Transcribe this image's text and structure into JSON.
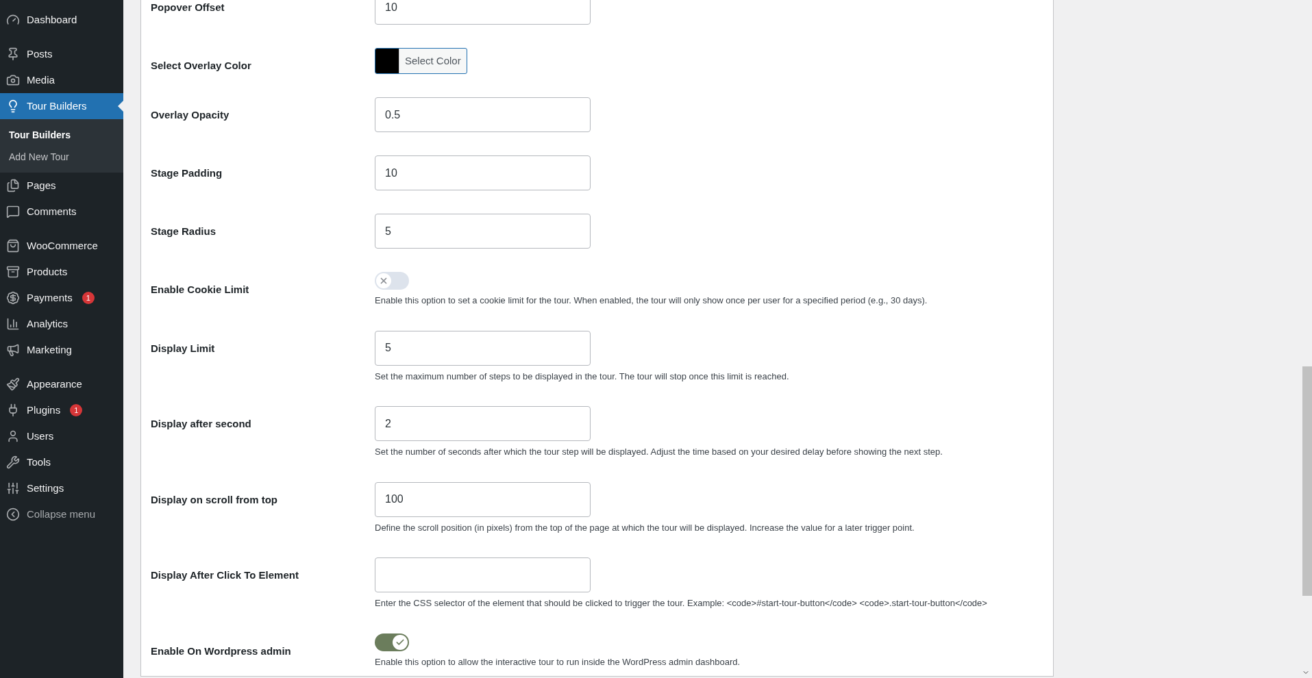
{
  "sidebar": {
    "groups": [
      {
        "items": [
          {
            "label": "Dashboard",
            "selected": false,
            "kind": "item"
          }
        ]
      },
      {
        "items": [
          {
            "label": "Posts",
            "selected": false,
            "kind": "item"
          },
          {
            "label": "Media",
            "selected": false,
            "kind": "item"
          },
          {
            "label": "Tour Builders",
            "selected": true,
            "kind": "item",
            "children": [
              {
                "label": "Tour Builders",
                "selected": true
              },
              {
                "label": "Add New Tour",
                "selected": false
              }
            ]
          },
          {
            "label": "Pages",
            "selected": false,
            "kind": "item"
          },
          {
            "label": "Comments",
            "selected": false,
            "kind": "item"
          }
        ]
      },
      {
        "items": [
          {
            "label": "WooCommerce",
            "selected": false,
            "kind": "item"
          },
          {
            "label": "Products",
            "selected": false,
            "kind": "item"
          },
          {
            "label": "Payments",
            "selected": false,
            "kind": "item",
            "badge": "1"
          },
          {
            "label": "Analytics",
            "selected": false,
            "kind": "item"
          },
          {
            "label": "Marketing",
            "selected": false,
            "kind": "item"
          }
        ]
      },
      {
        "items": [
          {
            "label": "Appearance",
            "selected": false,
            "kind": "item"
          },
          {
            "label": "Plugins",
            "selected": false,
            "kind": "item",
            "badge": "1"
          },
          {
            "label": "Users",
            "selected": false,
            "kind": "item"
          },
          {
            "label": "Tools",
            "selected": false,
            "kind": "item"
          },
          {
            "label": "Settings",
            "selected": false,
            "kind": "item"
          },
          {
            "label": "Collapse menu",
            "selected": false,
            "kind": "collapse"
          }
        ]
      }
    ]
  },
  "fields": [
    {
      "kind": "text",
      "label": "Popover Offset",
      "value": "10"
    },
    {
      "kind": "color",
      "label": "Select Overlay Color",
      "button": "Select Color",
      "color": "#000000"
    },
    {
      "kind": "text",
      "label": "Overlay Opacity",
      "value": "0.5"
    },
    {
      "kind": "text",
      "label": "Stage Padding",
      "value": "10"
    },
    {
      "kind": "text",
      "label": "Stage Radius",
      "value": "5"
    },
    {
      "kind": "toggle",
      "label": "Enable Cookie Limit",
      "on": false,
      "description": "Enable this option to set a cookie limit for the tour. When enabled, the tour will only show once per user for a specified period (e.g., 30 days)."
    },
    {
      "kind": "text",
      "label": "Display Limit",
      "value": "5",
      "description": "Set the maximum number of steps to be displayed in the tour. The tour will stop once this limit is reached."
    },
    {
      "kind": "text",
      "label": "Display after second",
      "value": "2",
      "description": "Set the number of seconds after which the tour step will be displayed. Adjust the time based on your desired delay before showing the next step."
    },
    {
      "kind": "text",
      "label": "Display on scroll from top",
      "value": "100",
      "description": "Define the scroll position (in pixels) from the top of the page at which the tour will be displayed. Increase the value for a later trigger point."
    },
    {
      "kind": "text",
      "label": "Display After Click To Element",
      "description": "Enter the CSS selector of the element that should be clicked to trigger the tour. Example: <code>#start-tour-button</code> <code>.start-tour-button</code>"
    },
    {
      "kind": "toggle",
      "label": "Enable On Wordpress admin",
      "on": true,
      "description": "Enable this option to allow the interactive tour to run inside the WordPress admin dashboard."
    }
  ]
}
